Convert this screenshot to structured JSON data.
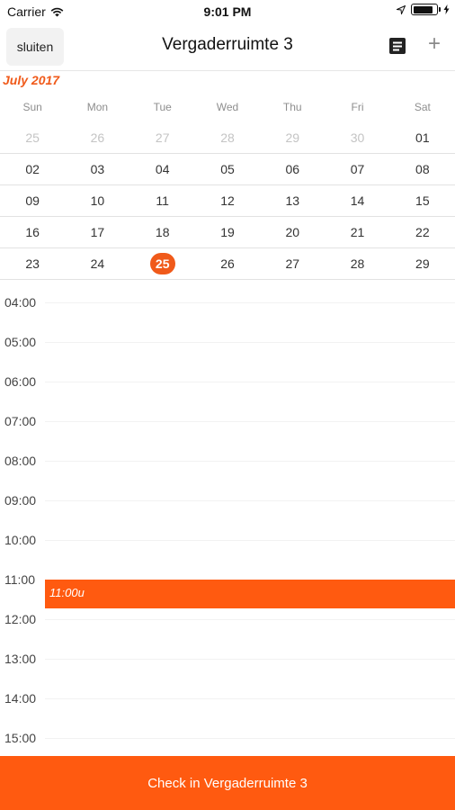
{
  "status_bar": {
    "carrier": "Carrier",
    "time": "9:01 PM",
    "battery_level": 0.9
  },
  "navbar": {
    "close_label": "sluiten",
    "title": "Vergaderruimte 3",
    "list_icon": "list-icon",
    "add_icon": "plus-icon",
    "add_glyph": "+"
  },
  "calendar": {
    "month_label": "July 2017",
    "accent_color": "#f05a1a",
    "weekdays": [
      "Sun",
      "Mon",
      "Tue",
      "Wed",
      "Thu",
      "Fri",
      "Sat"
    ],
    "weeks": [
      [
        {
          "d": "25",
          "muted": true
        },
        {
          "d": "26",
          "muted": true
        },
        {
          "d": "27",
          "muted": true
        },
        {
          "d": "28",
          "muted": true
        },
        {
          "d": "29",
          "muted": true
        },
        {
          "d": "30",
          "muted": true
        },
        {
          "d": "01"
        }
      ],
      [
        {
          "d": "02"
        },
        {
          "d": "03"
        },
        {
          "d": "04"
        },
        {
          "d": "05"
        },
        {
          "d": "06"
        },
        {
          "d": "07"
        },
        {
          "d": "08"
        }
      ],
      [
        {
          "d": "09"
        },
        {
          "d": "10"
        },
        {
          "d": "11"
        },
        {
          "d": "12"
        },
        {
          "d": "13"
        },
        {
          "d": "14"
        },
        {
          "d": "15"
        }
      ],
      [
        {
          "d": "16"
        },
        {
          "d": "17"
        },
        {
          "d": "18"
        },
        {
          "d": "19"
        },
        {
          "d": "20"
        },
        {
          "d": "21"
        },
        {
          "d": "22"
        }
      ],
      [
        {
          "d": "23"
        },
        {
          "d": "24"
        },
        {
          "d": "25",
          "selected": true
        },
        {
          "d": "26"
        },
        {
          "d": "27"
        },
        {
          "d": "28"
        },
        {
          "d": "29"
        }
      ]
    ]
  },
  "timeline": {
    "hours": [
      "04:00",
      "05:00",
      "06:00",
      "07:00",
      "08:00",
      "09:00",
      "10:00",
      "11:00",
      "12:00",
      "13:00",
      "14:00",
      "15:00"
    ],
    "event": {
      "label": "11:00u",
      "color": "#ff5a10"
    }
  },
  "footer": {
    "checkin_label": "Check in Vergaderruimte 3",
    "color": "#ff5a10"
  }
}
